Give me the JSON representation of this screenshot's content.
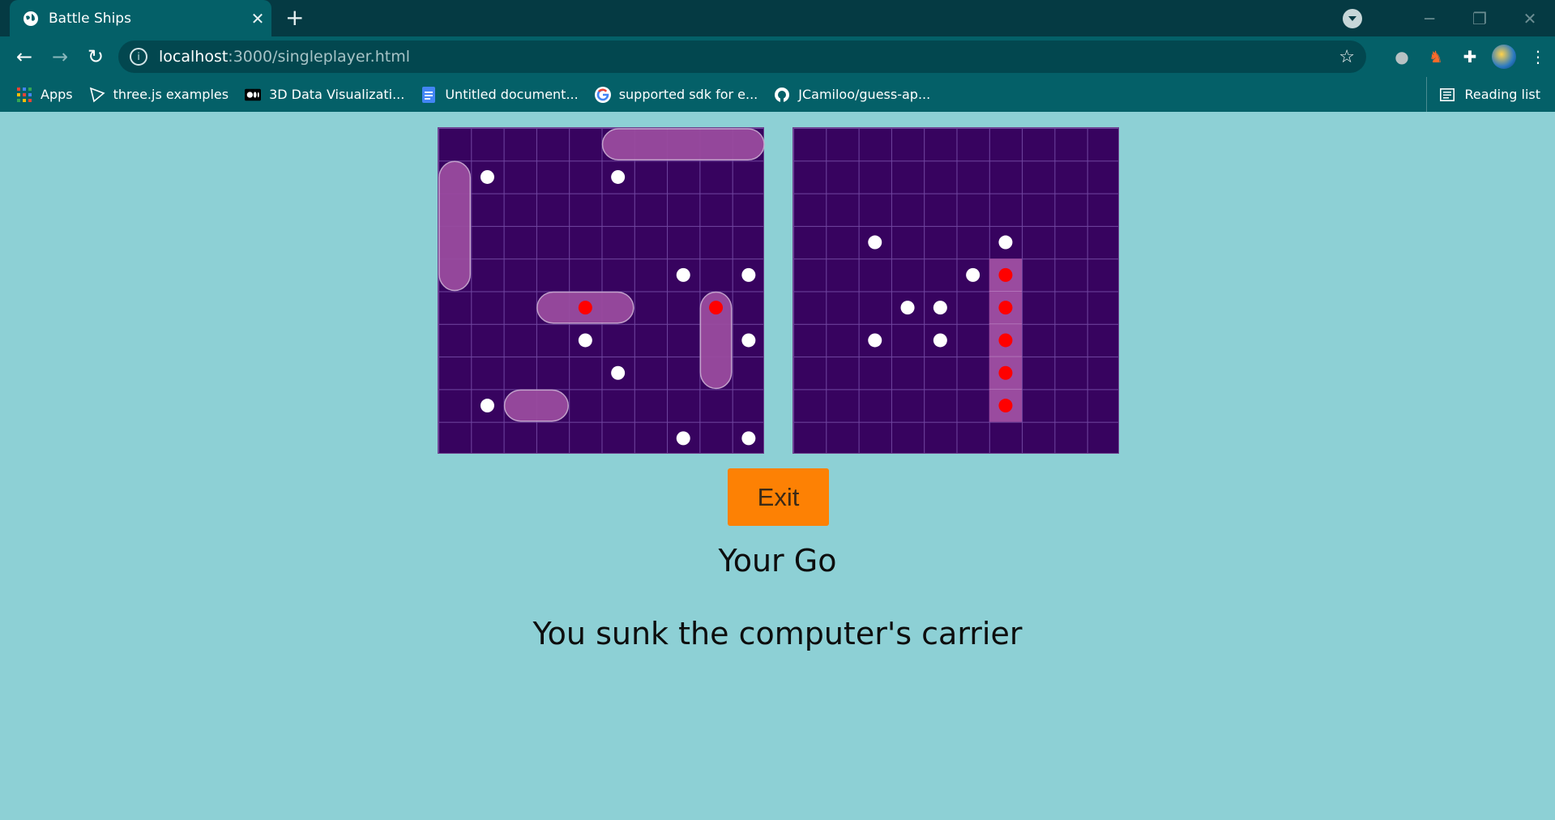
{
  "browser": {
    "tab_title": "Battle Ships",
    "url_host": "localhost",
    "url_path": ":3000/singleplayer.html",
    "bookmarks": [
      {
        "label": "Apps",
        "icon": "apps-grid-icon"
      },
      {
        "label": "three.js examples",
        "icon": "threejs-icon"
      },
      {
        "label": "3D Data Visualizati...",
        "icon": "medium-icon"
      },
      {
        "label": "Untitled document...",
        "icon": "google-docs-icon"
      },
      {
        "label": "supported sdk for e...",
        "icon": "google-icon"
      },
      {
        "label": "JCamiloo/guess-ap...",
        "icon": "github-icon"
      }
    ],
    "reading_list": "Reading list"
  },
  "game": {
    "exit_label": "Exit",
    "turn_text": "Your Go",
    "info_text": "You sunk the computer's carrier",
    "colors": {
      "board": "#37035f",
      "ship": "#9a4b9f",
      "hit": "#ff0000",
      "miss": "#ffffff",
      "page_bg": "#8dd0d5",
      "exit_button": "#fd8104"
    },
    "user_board": {
      "size": 10,
      "ships": [
        {
          "row": 0,
          "col": 5,
          "length": 5,
          "orientation": "horizontal"
        },
        {
          "row": 1,
          "col": 0,
          "length": 4,
          "orientation": "vertical"
        },
        {
          "row": 5,
          "col": 3,
          "length": 3,
          "orientation": "horizontal"
        },
        {
          "row": 5,
          "col": 8,
          "length": 3,
          "orientation": "vertical"
        },
        {
          "row": 8,
          "col": 2,
          "length": 2,
          "orientation": "horizontal"
        }
      ],
      "hits": [
        [
          5,
          4
        ],
        [
          5,
          8
        ]
      ],
      "misses": [
        [
          1,
          1
        ],
        [
          1,
          5
        ],
        [
          4,
          7
        ],
        [
          4,
          9
        ],
        [
          6,
          4
        ],
        [
          6,
          9
        ],
        [
          7,
          5
        ],
        [
          8,
          1
        ],
        [
          9,
          7
        ],
        [
          9,
          9
        ]
      ]
    },
    "computer_board": {
      "size": 10,
      "sunk_ships": [
        {
          "row": 4,
          "col": 6,
          "length": 5,
          "orientation": "vertical"
        }
      ],
      "hits": [
        [
          4,
          6
        ],
        [
          5,
          6
        ],
        [
          6,
          6
        ],
        [
          7,
          6
        ],
        [
          8,
          6
        ]
      ],
      "misses": [
        [
          3,
          2
        ],
        [
          3,
          6
        ],
        [
          4,
          5
        ],
        [
          5,
          3
        ],
        [
          5,
          4
        ],
        [
          6,
          2
        ],
        [
          6,
          4
        ]
      ]
    }
  }
}
